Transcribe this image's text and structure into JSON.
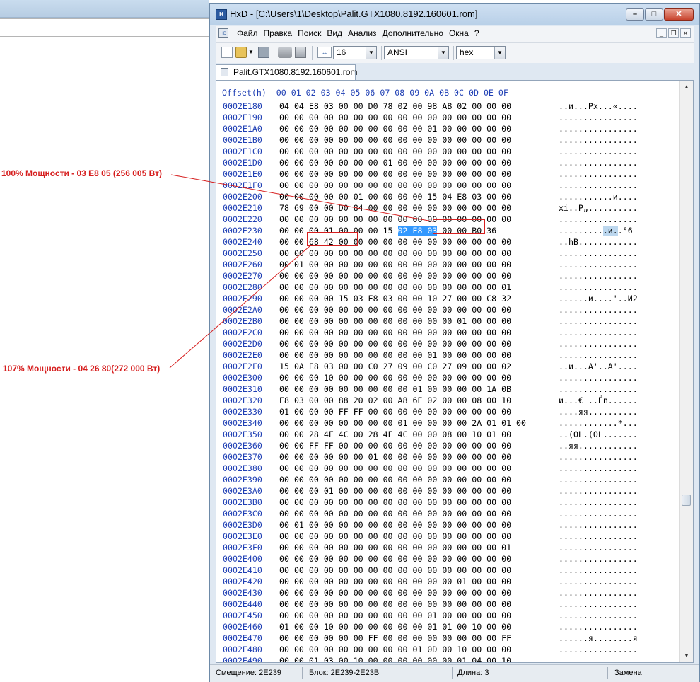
{
  "window": {
    "title": "HxD - [C:\\Users\\1\\Desktop\\Palit.GTX1080.8192.160601.rom]",
    "app_icon": "hxd-icon"
  },
  "menu": [
    "Файл",
    "Правка",
    "Поиск",
    "Вид",
    "Анализ",
    "Дополнительно",
    "Окна",
    "?"
  ],
  "toolbar": {
    "bytes_per_row": "16",
    "charset": "ANSI",
    "offset_base": "hex"
  },
  "tab": {
    "label": "Palit.GTX1080.8192.160601.rom"
  },
  "hex_header": "Offset(h)  00 01 02 03 04 05 06 07 08 09 0A 0B 0C 0D 0E 0F",
  "rows": [
    {
      "off": "0002E180",
      "hex": "04 04 E8 03 00 00 D0 78 02 00 98 AB 02 00 00 00",
      "txt": "..и...Px...«...."
    },
    {
      "off": "0002E190",
      "hex": "00 00 00 00 00 00 00 00 00 00 00 00 00 00 00 00",
      "txt": "................"
    },
    {
      "off": "0002E1A0",
      "hex": "00 00 00 00 00 00 00 00 00 00 01 00 00 00 00 00",
      "txt": "................"
    },
    {
      "off": "0002E1B0",
      "hex": "00 00 00 00 00 00 00 00 00 00 00 00 00 00 00 00",
      "txt": "................"
    },
    {
      "off": "0002E1C0",
      "hex": "00 00 00 00 00 00 00 00 00 00 00 00 00 00 00 00",
      "txt": "................"
    },
    {
      "off": "0002E1D0",
      "hex": "00 00 00 00 00 00 00 01 00 00 00 00 00 00 00 00",
      "txt": "................"
    },
    {
      "off": "0002E1E0",
      "hex": "00 00 00 00 00 00 00 00 00 00 00 00 00 00 00 00",
      "txt": "................"
    },
    {
      "off": "0002E1F0",
      "hex": "00 00 00 00 00 00 00 00 00 00 00 00 00 00 00 00",
      "txt": "................"
    },
    {
      "off": "0002E200",
      "hex": "00 00 00 00 00 01 00 00 00 00 15 04 E8 03 00 00",
      "txt": "...........и...."
    },
    {
      "off": "0002E210",
      "hex": "78 69 00 00 D0 84 00 00 00 00 00 00 00 00 00 00",
      "txt": "xi..P„.........."
    },
    {
      "off": "0002E220",
      "hex": "00 00 00 00 00 00 00 00 00 00 00 00 00 00 00 00",
      "txt": "................"
    },
    {
      "off": "0002E230",
      "hex": "00 00 00 01 00 00 00 15 02 E8 03 00 00 B0 36",
      "txt": "..........и..°6"
    },
    {
      "off": "0002E240",
      "hex": "00 00 68 42 00 00 00 00 00 00 00 00 00 00 00 00",
      "txt": "..hB............"
    },
    {
      "off": "0002E250",
      "hex": "00 00 00 00 00 00 00 00 00 00 00 00 00 00 00 00",
      "txt": "................"
    },
    {
      "off": "0002E260",
      "hex": "00 01 00 00 00 00 00 00 00 00 00 00 00 00 00 00",
      "txt": "................"
    },
    {
      "off": "0002E270",
      "hex": "00 00 00 00 00 00 00 00 00 00 00 00 00 00 00 00",
      "txt": "................"
    },
    {
      "off": "0002E280",
      "hex": "00 00 00 00 00 00 00 00 00 00 00 00 00 00 00 01",
      "txt": "................"
    },
    {
      "off": "0002E290",
      "hex": "00 00 00 00 15 03 E8 03 00 00 10 27 00 00 C8 32",
      "txt": "......и....'..И2"
    },
    {
      "off": "0002E2A0",
      "hex": "00 00 00 00 00 00 00 00 00 00 00 00 00 00 00 00",
      "txt": "................"
    },
    {
      "off": "0002E2B0",
      "hex": "00 00 00 00 00 00 00 00 00 00 00 00 01 00 00 00",
      "txt": "................"
    },
    {
      "off": "0002E2C0",
      "hex": "00 00 00 00 00 00 00 00 00 00 00 00 00 00 00 00",
      "txt": "................"
    },
    {
      "off": "0002E2D0",
      "hex": "00 00 00 00 00 00 00 00 00 00 00 00 00 00 00 00",
      "txt": "................"
    },
    {
      "off": "0002E2E0",
      "hex": "00 00 00 00 00 00 00 00 00 00 01 00 00 00 00 00",
      "txt": "................"
    },
    {
      "off": "0002E2F0",
      "hex": "15 0A E8 03 00 00 C0 27 09 00 C0 27 09 00 00 02",
      "txt": "..и...A'..A'...."
    },
    {
      "off": "0002E300",
      "hex": "00 00 00 10 00 00 00 00 00 00 00 00 00 00 00 00",
      "txt": "................"
    },
    {
      "off": "0002E310",
      "hex": "00 00 00 00 00 00 00 00 00 01 00 00 00 00 1A 0B",
      "txt": "................"
    },
    {
      "off": "0002E320",
      "hex": "E8 03 00 00 88 20 02 00 A8 6E 02 00 00 08 00 10",
      "txt": "и...€ ..Ёn......"
    },
    {
      "off": "0002E330",
      "hex": "01 00 00 00 FF FF 00 00 00 00 00 00 00 00 00 00",
      "txt": "....яя.........."
    },
    {
      "off": "0002E340",
      "hex": "00 00 00 00 00 00 00 00 01 00 00 00 00 2A 01 01 00",
      "txt": "............*..."
    },
    {
      "off": "0002E350",
      "hex": "00 00 28 4F 4C 00 28 4F 4C 00 00 08 00 10 01 00",
      "txt": "..(OL.(OL......."
    },
    {
      "off": "0002E360",
      "hex": "00 00 FF FF 00 00 00 00 00 00 00 00 00 00 00 00",
      "txt": "..яя............"
    },
    {
      "off": "0002E370",
      "hex": "00 00 00 00 00 00 01 00 00 00 00 00 00 00 00 00",
      "txt": "................"
    },
    {
      "off": "0002E380",
      "hex": "00 00 00 00 00 00 00 00 00 00 00 00 00 00 00 00",
      "txt": "................"
    },
    {
      "off": "0002E390",
      "hex": "00 00 00 00 00 00 00 00 00 00 00 00 00 00 00 00",
      "txt": "................"
    },
    {
      "off": "0002E3A0",
      "hex": "00 00 00 01 00 00 00 00 00 00 00 00 00 00 00 00",
      "txt": "................"
    },
    {
      "off": "0002E3B0",
      "hex": "00 00 00 00 00 00 00 00 00 00 00 00 00 00 00 00",
      "txt": "................"
    },
    {
      "off": "0002E3C0",
      "hex": "00 00 00 00 00 00 00 00 00 00 00 00 00 00 00 00",
      "txt": "................"
    },
    {
      "off": "0002E3D0",
      "hex": "00 01 00 00 00 00 00 00 00 00 00 00 00 00 00 00",
      "txt": "................"
    },
    {
      "off": "0002E3E0",
      "hex": "00 00 00 00 00 00 00 00 00 00 00 00 00 00 00 00",
      "txt": "................"
    },
    {
      "off": "0002E3F0",
      "hex": "00 00 00 00 00 00 00 00 00 00 00 00 00 00 00 01",
      "txt": "................"
    },
    {
      "off": "0002E400",
      "hex": "00 00 00 00 00 00 00 00 00 00 00 00 00 00 00 00",
      "txt": "................"
    },
    {
      "off": "0002E410",
      "hex": "00 00 00 00 00 00 00 00 00 00 00 00 00 00 00 00",
      "txt": "................"
    },
    {
      "off": "0002E420",
      "hex": "00 00 00 00 00 00 00 00 00 00 00 00 01 00 00 00",
      "txt": "................"
    },
    {
      "off": "0002E430",
      "hex": "00 00 00 00 00 00 00 00 00 00 00 00 00 00 00 00",
      "txt": "................"
    },
    {
      "off": "0002E440",
      "hex": "00 00 00 00 00 00 00 00 00 00 00 00 00 00 00 00",
      "txt": "................"
    },
    {
      "off": "0002E450",
      "hex": "00 00 00 00 00 00 00 00 00 00 01 00 00 00 00 00",
      "txt": "................"
    },
    {
      "off": "0002E460",
      "hex": "01 00 00 10 00 00 00 00 00 00 01 01 00 10 00 00",
      "txt": "................"
    },
    {
      "off": "0002E470",
      "hex": "00 00 00 00 00 00 FF 00 00 00 00 00 00 00 00 FF",
      "txt": "......я........я"
    },
    {
      "off": "0002E480",
      "hex": "00 00 00 00 00 00 00 00 00 01 0D 00 10 00 00 00",
      "txt": "................"
    },
    {
      "off": "0002E490",
      "hex": "00 00 01 03 00 10 00 00 00 00 00 00 01 04 00 10",
      "txt": "................"
    }
  ],
  "selection": {
    "row_index": 11,
    "hex_selected": "02 E8 03",
    "txt_selected": ".и."
  },
  "status": {
    "offset": "Смещение: 2E239",
    "block": "Блок: 2E239-2E23B",
    "length": "Длина: 3",
    "mode": "Замена"
  },
  "annotations": {
    "a100": "100% Мощности - 03 E8 05 (256 005 Вт)",
    "a107": "107% Мощности - 04 26 80(272 000 Вт)"
  },
  "colors": {
    "annotation": "#d61e1e",
    "offset_blue": "#1f3fb4",
    "selection": "#3399ff"
  }
}
